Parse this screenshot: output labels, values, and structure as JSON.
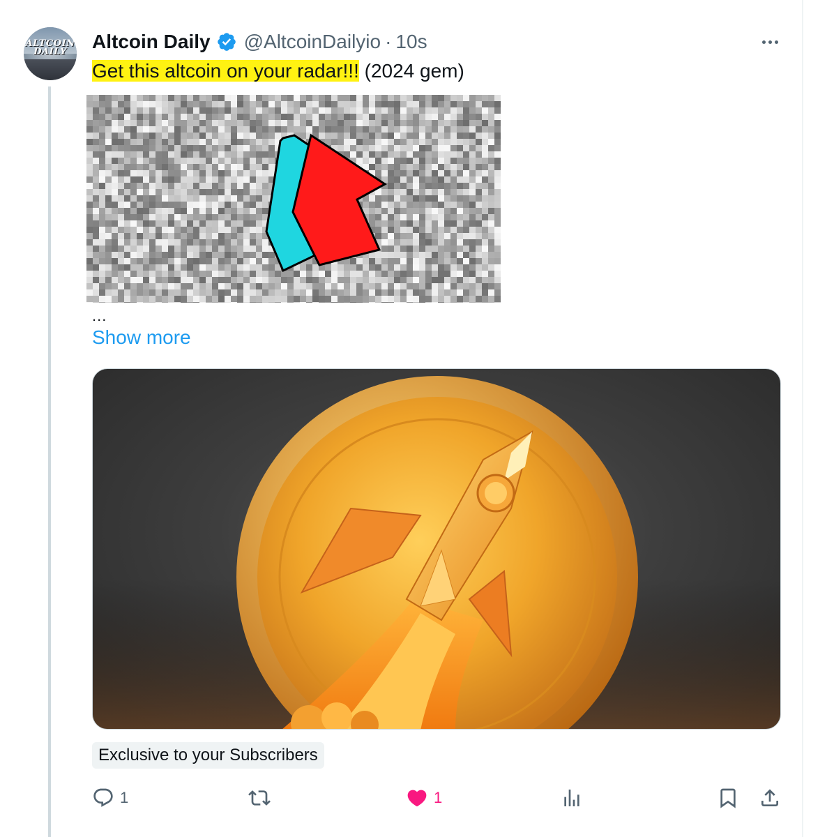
{
  "tweet": {
    "display_name": "Altcoin Daily",
    "handle": "@AltcoinDailyio",
    "separator": "·",
    "time": "10s",
    "avatar_text_line1": "ALTCOIN",
    "avatar_text_line2": "DAILY",
    "text_highlighted": "Get this altcoin on your radar!!!",
    "text_rest": " (2024 gem)",
    "truncation": "...",
    "show_more": "Show more",
    "badge": "Exclusive to your Subscribers"
  },
  "actions": {
    "reply_count": "1",
    "like_count": "1"
  },
  "icons": {
    "verified": "verified-badge-icon",
    "more": "more-horizontal-icon",
    "reply": "reply-icon",
    "retweet": "retweet-icon",
    "like": "heart-filled-icon",
    "views": "views-icon",
    "bookmark": "bookmark-icon",
    "share": "share-icon"
  },
  "colors": {
    "accent": "#1d9bf0",
    "like": "#f91880",
    "muted": "#536471",
    "highlight": "#fff212"
  }
}
